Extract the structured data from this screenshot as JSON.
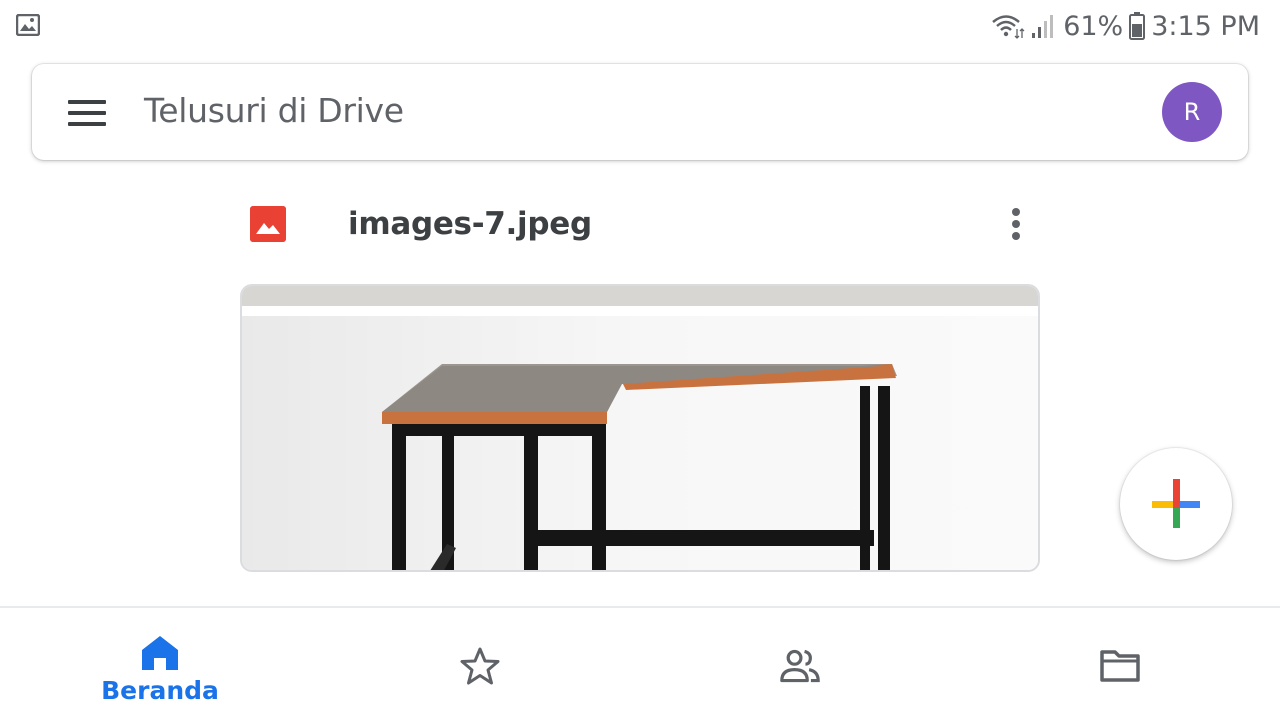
{
  "status_bar": {
    "battery": "61%",
    "time": "3:15 PM",
    "icons": [
      "gallery-notification-icon",
      "wifi-icon",
      "signal-icon",
      "battery-icon"
    ]
  },
  "search": {
    "placeholder": "Telusuri di Drive",
    "avatar_initial": "R",
    "avatar_color": "#7e57c2"
  },
  "file": {
    "name": "images-7.jpeg",
    "type_icon": "image-file-icon",
    "type_icon_color": "#e94235"
  },
  "fab": {
    "icon": "multicolor-plus-icon"
  },
  "bottom_nav": {
    "items": [
      {
        "label": "Beranda",
        "icon": "home-icon",
        "active": true
      },
      {
        "label": "",
        "icon": "star-icon",
        "active": false
      },
      {
        "label": "",
        "icon": "people-icon",
        "active": false
      },
      {
        "label": "",
        "icon": "folder-icon",
        "active": false
      }
    ],
    "active_color": "#1a73e8"
  }
}
